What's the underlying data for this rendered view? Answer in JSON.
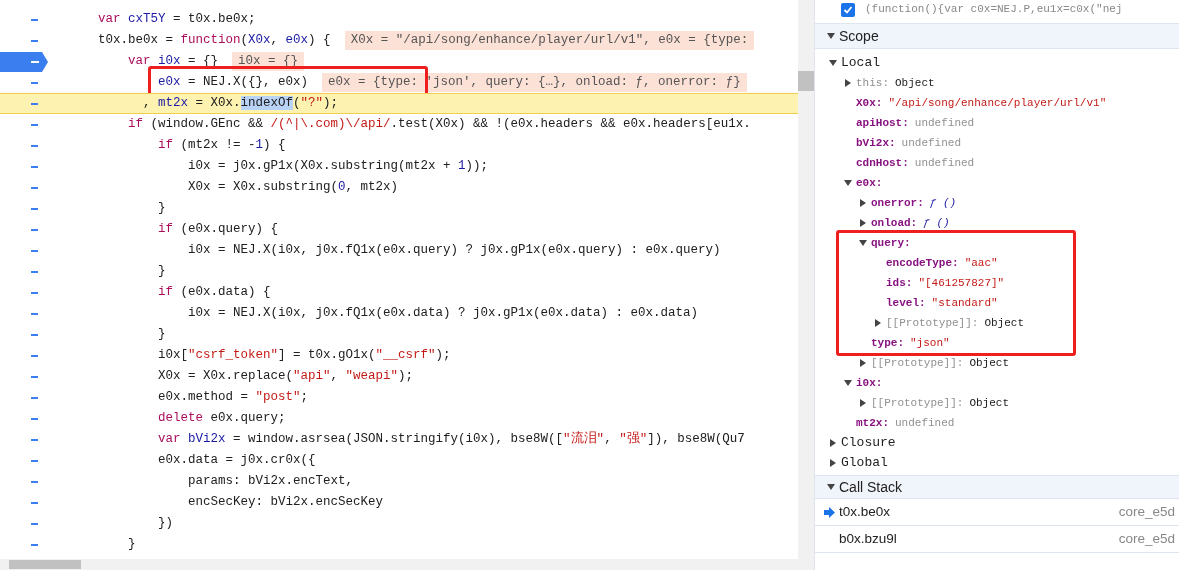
{
  "editor": {
    "lines": [
      {
        "breakpoint": false,
        "current": false,
        "boxed": false,
        "tokens": [
          {
            "kind": "keyword",
            "t": "    var"
          },
          {
            "kind": "def",
            "t": " cxT5Y"
          },
          {
            "kind": "plain",
            "t": " = t0x.be0x;"
          }
        ]
      },
      {
        "breakpoint": false,
        "current": false,
        "boxed": false,
        "tokens": [
          {
            "kind": "plain",
            "t": "    t0x.be0x = "
          },
          {
            "kind": "keyword",
            "t": "function"
          },
          {
            "kind": "plain",
            "t": "("
          },
          {
            "kind": "def",
            "t": "X0x"
          },
          {
            "kind": "plain",
            "t": ", "
          },
          {
            "kind": "def",
            "t": "e0x"
          },
          {
            "kind": "plain",
            "t": ") {"
          }
        ],
        "inline": "X0x = \"/api/song/enhance/player/url/v1\", e0x = {type:"
      },
      {
        "breakpoint": true,
        "current": false,
        "boxed": false,
        "tokens": [
          {
            "kind": "keyword",
            "t": "        var"
          },
          {
            "kind": "def",
            "t": " i0x"
          },
          {
            "kind": "plain",
            "t": " = {}"
          }
        ],
        "inline": "i0x = {}"
      },
      {
        "breakpoint": false,
        "current": false,
        "boxed": true,
        "tokens": [
          {
            "kind": "def",
            "t": "            e0x"
          },
          {
            "kind": "plain",
            "t": " = NEJ.X({}, e0x)"
          }
        ],
        "inline": "e0x = {type: 'json', query: {…}, onload: ƒ, onerror: ƒ}"
      },
      {
        "breakpoint": false,
        "current": true,
        "boxed": false,
        "tokens": [
          {
            "kind": "plain",
            "t": "          , "
          },
          {
            "kind": "def",
            "t": "mt2x"
          },
          {
            "kind": "plain",
            "t": " = X0x."
          },
          {
            "kind": "selection",
            "t": "indexOf"
          },
          {
            "kind": "plain",
            "t": "("
          },
          {
            "kind": "string",
            "t": "\"?\""
          },
          {
            "kind": "plain",
            "t": ");"
          }
        ]
      },
      {
        "breakpoint": false,
        "current": false,
        "boxed": false,
        "tokens": [
          {
            "kind": "keyword",
            "t": "        if"
          },
          {
            "kind": "plain",
            "t": " (window.GEnc && "
          },
          {
            "kind": "string",
            "t": "/(^|\\.com)\\/api/"
          },
          {
            "kind": "plain",
            "t": ".test(X0x) && !(e0x.headers && e0x.headers[eu1x."
          }
        ]
      },
      {
        "breakpoint": false,
        "current": false,
        "boxed": false,
        "tokens": [
          {
            "kind": "keyword",
            "t": "            if"
          },
          {
            "kind": "plain",
            "t": " (mt2x != -"
          },
          {
            "kind": "number",
            "t": "1"
          },
          {
            "kind": "plain",
            "t": ") {"
          }
        ]
      },
      {
        "breakpoint": false,
        "current": false,
        "boxed": false,
        "tokens": [
          {
            "kind": "plain",
            "t": "                i0x = j0x.gP1x(X0x.substring(mt2x + "
          },
          {
            "kind": "number",
            "t": "1"
          },
          {
            "kind": "plain",
            "t": "));"
          }
        ]
      },
      {
        "breakpoint": false,
        "current": false,
        "boxed": false,
        "tokens": [
          {
            "kind": "plain",
            "t": "                X0x = X0x.substring("
          },
          {
            "kind": "number",
            "t": "0"
          },
          {
            "kind": "plain",
            "t": ", mt2x)"
          }
        ]
      },
      {
        "breakpoint": false,
        "current": false,
        "boxed": false,
        "tokens": [
          {
            "kind": "plain",
            "t": "            }"
          }
        ]
      },
      {
        "breakpoint": false,
        "current": false,
        "boxed": false,
        "tokens": [
          {
            "kind": "keyword",
            "t": "            if"
          },
          {
            "kind": "plain",
            "t": " (e0x.query) {"
          }
        ]
      },
      {
        "breakpoint": false,
        "current": false,
        "boxed": false,
        "tokens": [
          {
            "kind": "plain",
            "t": "                i0x = NEJ.X(i0x, j0x.fQ1x(e0x.query) ? j0x.gP1x(e0x.query) : e0x.query)"
          }
        ]
      },
      {
        "breakpoint": false,
        "current": false,
        "boxed": false,
        "tokens": [
          {
            "kind": "plain",
            "t": "            }"
          }
        ]
      },
      {
        "breakpoint": false,
        "current": false,
        "boxed": false,
        "tokens": [
          {
            "kind": "keyword",
            "t": "            if"
          },
          {
            "kind": "plain",
            "t": " (e0x.data) {"
          }
        ]
      },
      {
        "breakpoint": false,
        "current": false,
        "boxed": false,
        "tokens": [
          {
            "kind": "plain",
            "t": "                i0x = NEJ.X(i0x, j0x.fQ1x(e0x.data) ? j0x.gP1x(e0x.data) : e0x.data)"
          }
        ]
      },
      {
        "breakpoint": false,
        "current": false,
        "boxed": false,
        "tokens": [
          {
            "kind": "plain",
            "t": "            }"
          }
        ]
      },
      {
        "breakpoint": false,
        "current": false,
        "boxed": false,
        "tokens": [
          {
            "kind": "plain",
            "t": "            i0x["
          },
          {
            "kind": "string",
            "t": "\"csrf_token\""
          },
          {
            "kind": "plain",
            "t": "] = t0x.gO1x("
          },
          {
            "kind": "string",
            "t": "\"__csrf\""
          },
          {
            "kind": "plain",
            "t": ");"
          }
        ]
      },
      {
        "breakpoint": false,
        "current": false,
        "boxed": false,
        "tokens": [
          {
            "kind": "plain",
            "t": "            X0x = X0x.replace("
          },
          {
            "kind": "string",
            "t": "\"api\""
          },
          {
            "kind": "plain",
            "t": ", "
          },
          {
            "kind": "string",
            "t": "\"weapi\""
          },
          {
            "kind": "plain",
            "t": ");"
          }
        ]
      },
      {
        "breakpoint": false,
        "current": false,
        "boxed": false,
        "tokens": [
          {
            "kind": "plain",
            "t": "            e0x.method = "
          },
          {
            "kind": "string",
            "t": "\"post\""
          },
          {
            "kind": "plain",
            "t": ";"
          }
        ]
      },
      {
        "breakpoint": false,
        "current": false,
        "boxed": false,
        "tokens": [
          {
            "kind": "keyword",
            "t": "            delete"
          },
          {
            "kind": "plain",
            "t": " e0x.query;"
          }
        ]
      },
      {
        "breakpoint": false,
        "current": false,
        "boxed": false,
        "tokens": [
          {
            "kind": "keyword",
            "t": "            var"
          },
          {
            "kind": "def",
            "t": " bVi2x"
          },
          {
            "kind": "plain",
            "t": " = window.asrsea(JSON.stringify(i0x), bse8W(["
          },
          {
            "kind": "string",
            "t": "\"流泪\""
          },
          {
            "kind": "plain",
            "t": ", "
          },
          {
            "kind": "string",
            "t": "\"强\""
          },
          {
            "kind": "plain",
            "t": "]), bse8W(Qu7"
          }
        ]
      },
      {
        "breakpoint": false,
        "current": false,
        "boxed": false,
        "tokens": [
          {
            "kind": "plain",
            "t": "            e0x.data = j0x.cr0x({"
          }
        ]
      },
      {
        "breakpoint": false,
        "current": false,
        "boxed": false,
        "tokens": [
          {
            "kind": "plain",
            "t": "                params: bVi2x.encText,"
          }
        ]
      },
      {
        "breakpoint": false,
        "current": false,
        "boxed": false,
        "tokens": [
          {
            "kind": "plain",
            "t": "                encSecKey: bVi2x.encSecKey"
          }
        ]
      },
      {
        "breakpoint": false,
        "current": false,
        "boxed": false,
        "tokens": [
          {
            "kind": "plain",
            "t": "            })"
          }
        ]
      },
      {
        "breakpoint": false,
        "current": false,
        "boxed": false,
        "tokens": [
          {
            "kind": "plain",
            "t": "        }"
          }
        ]
      }
    ]
  },
  "breakpoint_item": {
    "checked": true,
    "code": "(function(){var c0x=NEJ.P,eu1x=c0x(\"nej"
  },
  "scope": {
    "title": "Scope",
    "expanded": true,
    "tree": [
      {
        "name": "Local",
        "kind": "group",
        "expanded": true,
        "children": [
          {
            "name": "this:",
            "kind": "object",
            "dim": true,
            "value": "Object",
            "expanded": false
          },
          {
            "name": "X0x:",
            "kind": "string",
            "value": "\"/api/song/enhance/player/url/v1\""
          },
          {
            "name": "apiHost:",
            "kind": "undefined",
            "value": "undefined"
          },
          {
            "name": "bVi2x:",
            "kind": "undefined",
            "value": "undefined"
          },
          {
            "name": "cdnHost:",
            "kind": "undefined",
            "value": "undefined"
          },
          {
            "name": "e0x:",
            "kind": "object",
            "expanded": true,
            "children": [
              {
                "name": "onerror:",
                "kind": "function",
                "value": "ƒ ()",
                "expanded": false
              },
              {
                "name": "onload:",
                "kind": "function",
                "value": "ƒ ()",
                "expanded": false
              },
              {
                "name": "query:",
                "kind": "object",
                "boxed": true,
                "expanded": true,
                "children": [
                  {
                    "name": "encodeType:",
                    "kind": "string",
                    "value": "\"aac\""
                  },
                  {
                    "name": "ids:",
                    "kind": "string",
                    "value": "\"[461257827]\""
                  },
                  {
                    "name": "level:",
                    "kind": "string",
                    "value": "\"standard\""
                  },
                  {
                    "name": "[[Prototype]]:",
                    "kind": "object",
                    "dim": true,
                    "value": "Object",
                    "expanded": false
                  }
                ]
              },
              {
                "name": "type:",
                "kind": "string",
                "boxed": true,
                "value": "\"json\""
              },
              {
                "name": "[[Prototype]]:",
                "kind": "object",
                "dim": true,
                "value": "Object",
                "expanded": false
              }
            ]
          },
          {
            "name": "i0x:",
            "kind": "object",
            "expanded": true,
            "children": [
              {
                "name": "[[Prototype]]:",
                "kind": "object",
                "dim": true,
                "value": "Object",
                "expanded": false
              }
            ]
          },
          {
            "name": "mt2x:",
            "kind": "undefined",
            "value": "undefined"
          }
        ]
      },
      {
        "name": "Closure",
        "kind": "group",
        "expanded": false
      },
      {
        "name": "Global",
        "kind": "group",
        "expanded": false
      }
    ]
  },
  "call_stack": {
    "title": "Call Stack",
    "expanded": true,
    "frames": [
      {
        "name": "t0x.be0x",
        "location": "core_e5d",
        "current": true
      },
      {
        "name": "b0x.bzu9l",
        "location": "core_e5d",
        "current": false
      }
    ]
  }
}
